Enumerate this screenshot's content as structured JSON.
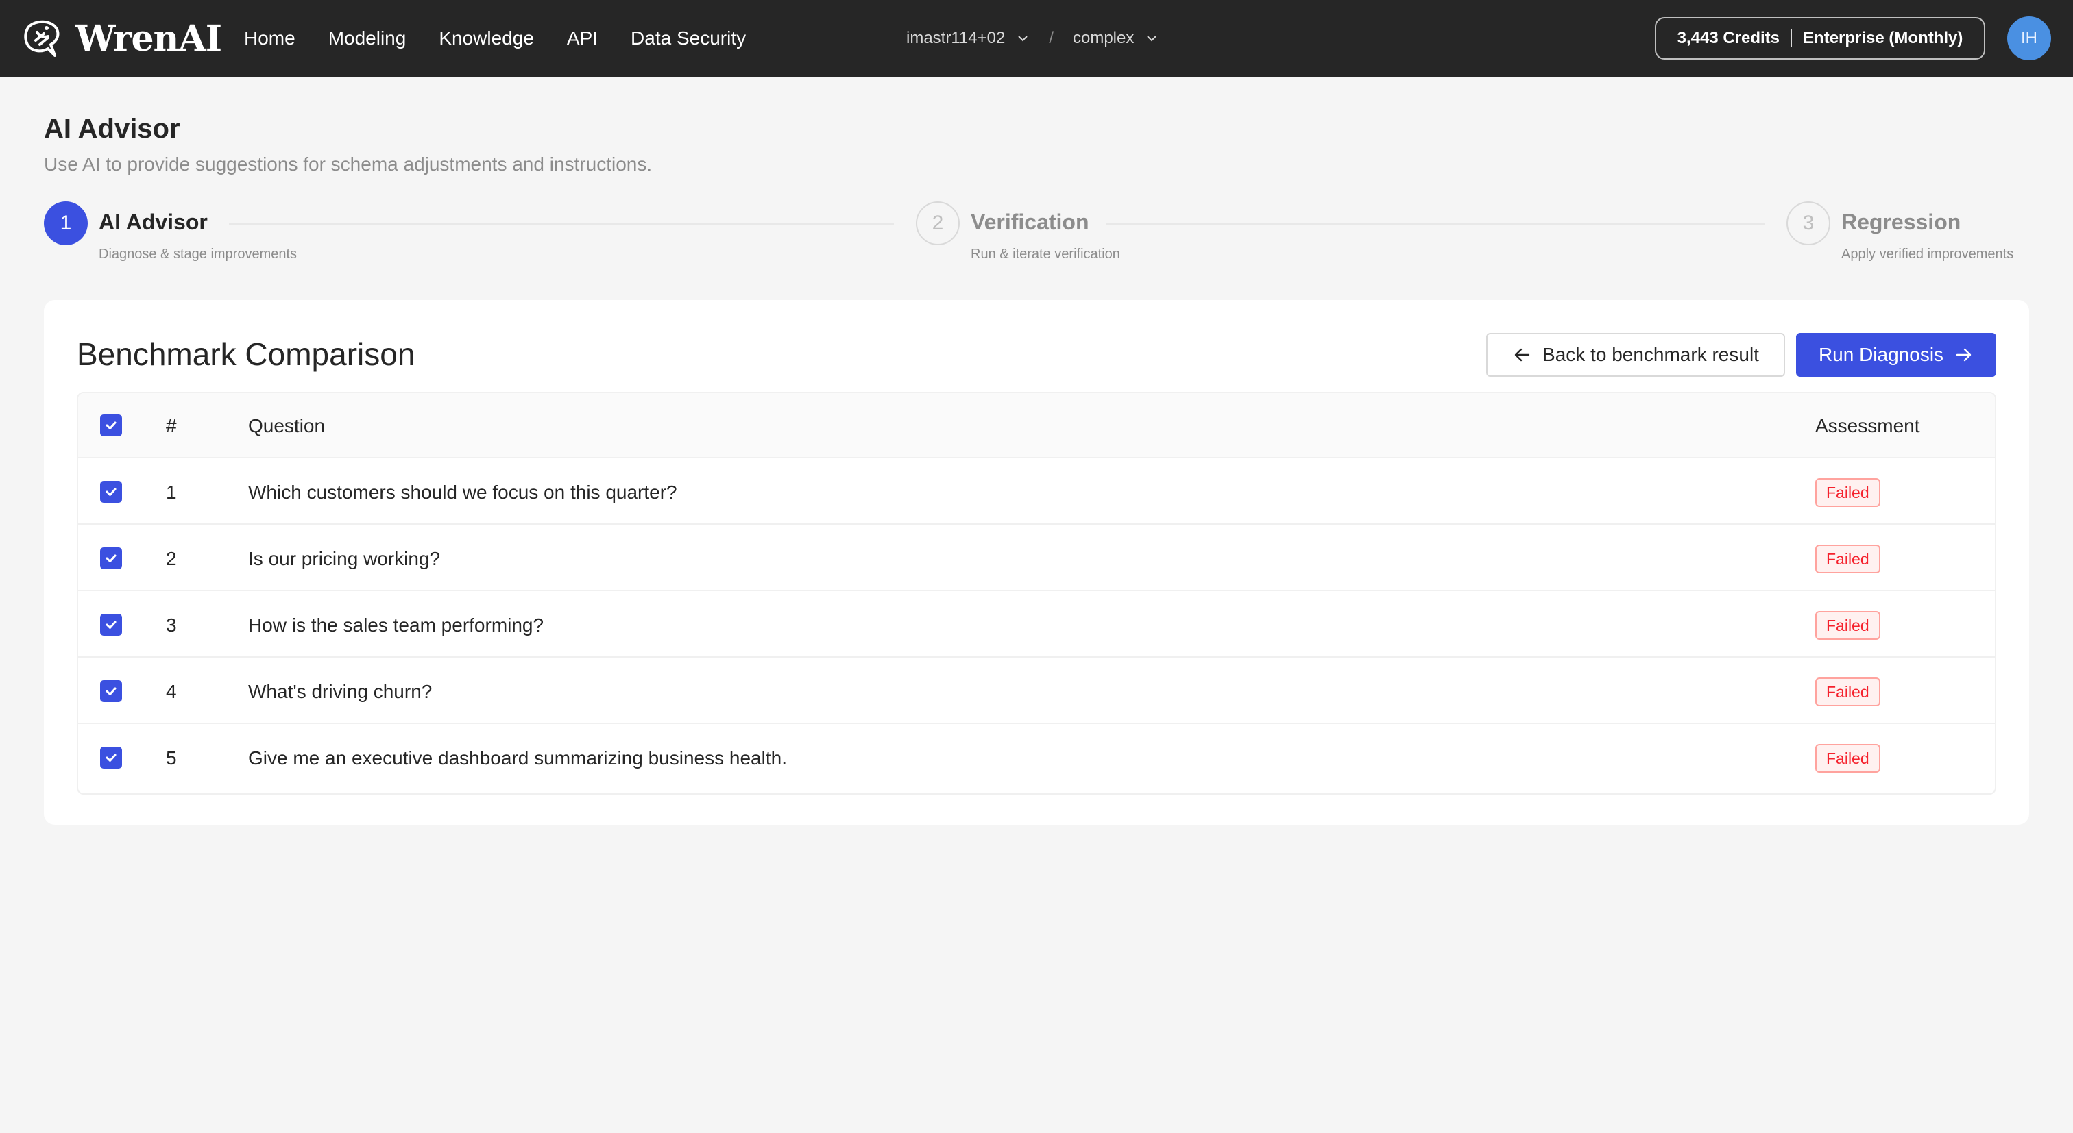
{
  "topbar": {
    "brand": "WrenAI",
    "nav": [
      "Home",
      "Modeling",
      "Knowledge",
      "API",
      "Data Security"
    ],
    "workspace": "imastr114+02",
    "project": "complex",
    "credits": "3,443 Credits",
    "plan": "Enterprise (Monthly)",
    "avatar_initials": "IH"
  },
  "page": {
    "title": "AI Advisor",
    "description": "Use AI to provide suggestions for schema adjustments and instructions."
  },
  "steps": [
    {
      "number": "1",
      "title": "AI Advisor",
      "subtitle": "Diagnose & stage improvements",
      "active": true
    },
    {
      "number": "2",
      "title": "Verification",
      "subtitle": "Run & iterate verification",
      "active": false
    },
    {
      "number": "3",
      "title": "Regression",
      "subtitle": "Apply verified improvements",
      "active": false
    }
  ],
  "card": {
    "title": "Benchmark Comparison",
    "back_label": "Back to benchmark result",
    "run_label": "Run Diagnosis"
  },
  "table": {
    "headers": {
      "num": "#",
      "question": "Question",
      "assessment": "Assessment"
    },
    "rows": [
      {
        "num": "1",
        "question": "Which customers should we focus on this quarter?",
        "assessment": "Failed",
        "checked": true
      },
      {
        "num": "2",
        "question": "Is our pricing working?",
        "assessment": "Failed",
        "checked": true
      },
      {
        "num": "3",
        "question": "How is the sales team performing?",
        "assessment": "Failed",
        "checked": true
      },
      {
        "num": "4",
        "question": "What's driving churn?",
        "assessment": "Failed",
        "checked": true
      },
      {
        "num": "5",
        "question": "Give me an executive dashboard summarizing business health.",
        "assessment": "Failed",
        "checked": true
      }
    ]
  },
  "colors": {
    "accent": "#3b50e0",
    "failed": "#f5222d",
    "topbar": "#262626"
  }
}
